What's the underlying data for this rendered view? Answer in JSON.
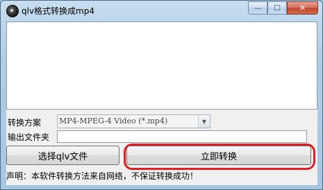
{
  "window": {
    "title": "qlv格式转换成mp4",
    "minimize_glyph": "—",
    "maximize_glyph": "☐",
    "close_glyph": "✕",
    "icon": "app-disc-icon"
  },
  "form": {
    "format_label": "转换方案",
    "format_value": "MP4-MPEG-4 Video (*.mp4)",
    "output_label": "输出文件夹",
    "output_value": ""
  },
  "buttons": {
    "select_files": "选择qlv文件",
    "convert_now": "立即转换"
  },
  "disclaimer": "声明：本软件转换方法来自网络，不保证转换成功！",
  "colors": {
    "highlight": "#e02020",
    "close_button": "#c2452a"
  }
}
